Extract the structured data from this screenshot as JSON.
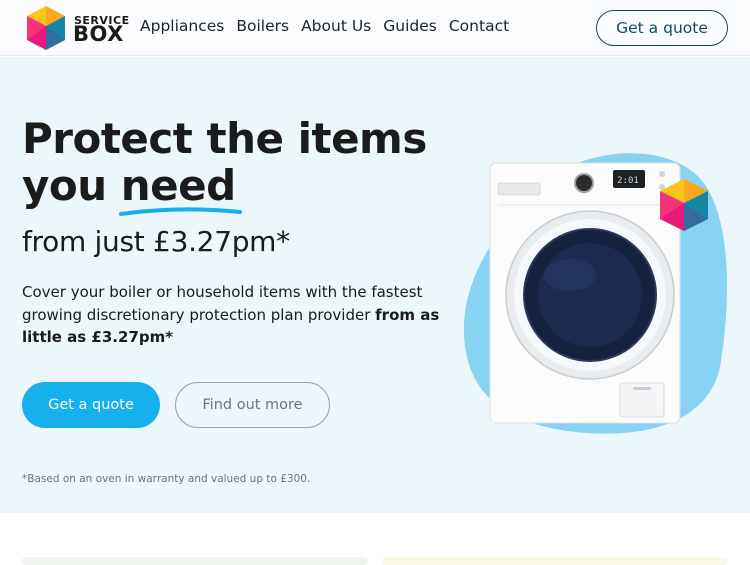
{
  "brand": {
    "name_top": "SERVICE",
    "name_bottom": "BOX"
  },
  "nav": {
    "items": [
      "Appliances",
      "Boilers",
      "About Us",
      "Guides",
      "Contact"
    ],
    "cta_label": "Get a quote"
  },
  "hero": {
    "headline_line1": "Protect the items",
    "headline_line2_prefix": "you ",
    "headline_highlight": "need",
    "subheadline": "from just £3.27pm*",
    "description_plain": "Cover your boiler or household items with the fastest growing discretionary protection plan provider ",
    "description_bold": "from as little as £3.27pm*",
    "primary_button": "Get a quote",
    "secondary_button": "Find out more",
    "footnote": "*Based on an oven in warranty and valued up to £300."
  },
  "colors": {
    "hero_background": "#ebf7fb",
    "primary_blue": "#16b0ec",
    "header_cta_border": "#134a5e",
    "blob": "#88d2f2",
    "cube_yellow": "#f9c41b",
    "cube_magenta": "#e8197a",
    "cube_teal": "#1686a6",
    "cube_pink": "#ff4e7a",
    "cube_orange": "#f7941d",
    "cube_purple": "#6a3d91"
  },
  "icons": {
    "logo": "servicebox-cube-logo",
    "product_image": "washing-machine-image",
    "badge": "servicebox-cube-badge"
  }
}
